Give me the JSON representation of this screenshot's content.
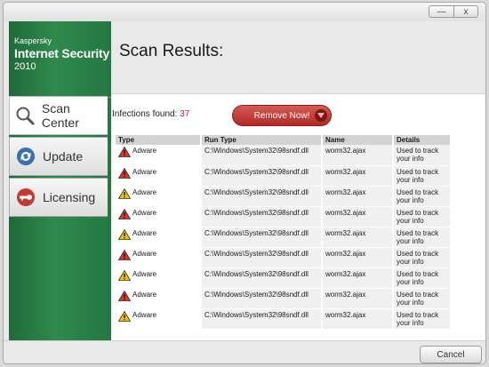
{
  "window": {
    "minimize_label": "—",
    "close_label": "x"
  },
  "brand": {
    "line1": "Kaspersky",
    "line2": "Internet Security",
    "line3": "2010"
  },
  "nav": [
    {
      "label": "Scan Center",
      "icon": "magnifier-icon",
      "active": true
    },
    {
      "label": "Update",
      "icon": "update-icon",
      "active": false
    },
    {
      "label": "Licensing",
      "icon": "key-icon",
      "active": false
    }
  ],
  "page_title": "Scan Results:",
  "infections": {
    "label": "Infections found:",
    "count": "37"
  },
  "remove_button": "Remove Now!",
  "table": {
    "headers": [
      "Type",
      "Run Type",
      "Name",
      "Details"
    ],
    "rows": [
      {
        "type": "Adware",
        "severity": "red",
        "run_type": "C:\\Windows\\System32\\98sndf.dll",
        "name": "worm32.ajax",
        "details": "Used to track your info"
      },
      {
        "type": "Adware",
        "severity": "red",
        "run_type": "C:\\Windows\\System32\\98sndf.dll",
        "name": "worm32.ajax",
        "details": "Used to track your info"
      },
      {
        "type": "Adware",
        "severity": "yellow",
        "run_type": "C:\\Windows\\System32\\98sndf.dll",
        "name": "worm32.ajax",
        "details": "Used to track your info"
      },
      {
        "type": "Adware",
        "severity": "red",
        "run_type": "C:\\Windows\\System32\\98sndf.dll",
        "name": "worm32.ajax",
        "details": "Used to track your info"
      },
      {
        "type": "Adware",
        "severity": "yellow",
        "run_type": "C:\\Windows\\System32\\98sndf.dll",
        "name": "worm32.ajax",
        "details": "Used to track your info"
      },
      {
        "type": "Adware",
        "severity": "red",
        "run_type": "C:\\Windows\\System32\\98sndf.dll",
        "name": "worm32.ajax",
        "details": "Used to track your info"
      },
      {
        "type": "Adware",
        "severity": "yellow",
        "run_type": "C:\\Windows\\System32\\98sndf.dll",
        "name": "worm32.ajax",
        "details": "Used to track your info"
      },
      {
        "type": "Adware",
        "severity": "red",
        "run_type": "C:\\Windows\\System32\\98sndf.dll",
        "name": "worm32.ajax",
        "details": "Used to track your info"
      },
      {
        "type": "Adware",
        "severity": "yellow",
        "run_type": "C:\\Windows\\System32\\98sndf.dll",
        "name": "worm32.ajax",
        "details": "Used to track your info"
      }
    ]
  },
  "cancel_button": "Cancel",
  "colors": {
    "brand_green": "#2f8a4d",
    "alert_red": "#c32a22",
    "warn_yellow": "#f2c200"
  }
}
